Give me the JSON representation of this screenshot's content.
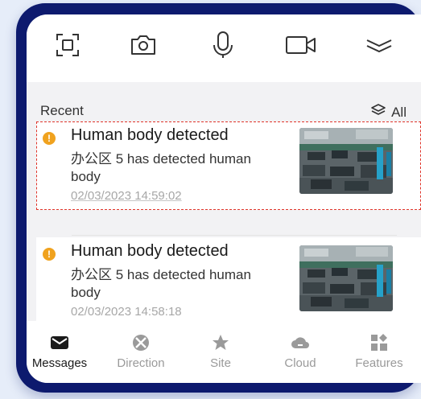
{
  "toolbar": {
    "items": [
      {
        "icon": "scan-icon"
      },
      {
        "icon": "camera-icon"
      },
      {
        "icon": "microphone-icon"
      },
      {
        "icon": "video-icon"
      },
      {
        "icon": "collapse-chevron-icon"
      }
    ]
  },
  "recent": {
    "label": "Recent",
    "all_label": "All",
    "all_icon": "layers-icon"
  },
  "messages": [
    {
      "status_icon": "warning-icon",
      "title": "Human body detected",
      "description": "办公区 5 has detected human body",
      "timestamp": "02/03/2023 14:59:02",
      "selected": true
    },
    {
      "status_icon": "warning-icon",
      "title": "Human body detected",
      "description": "办公区 5 has detected human body",
      "timestamp": "02/03/2023 14:58:18",
      "selected": false
    }
  ],
  "tabs": [
    {
      "label": "Messages",
      "icon": "envelope-icon",
      "active": true
    },
    {
      "label": "Direction",
      "icon": "compass-icon",
      "active": false
    },
    {
      "label": "Site",
      "icon": "star-icon",
      "active": false
    },
    {
      "label": "Cloud",
      "icon": "cloud-icon",
      "active": false
    },
    {
      "label": "Features",
      "icon": "features-grid-icon",
      "active": false
    }
  ],
  "colors": {
    "frame": "#0d1a6e",
    "highlight": "#e0352b",
    "warning": "#f0a21e",
    "inactive_tab": "#9a9a9a"
  }
}
